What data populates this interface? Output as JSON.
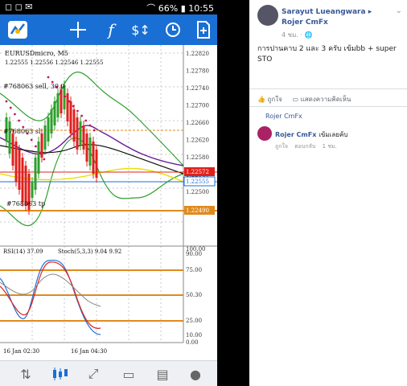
{
  "statusbar": {
    "battery": "66%",
    "time": "10:55"
  },
  "chart": {
    "symbol": "EURUSDmicro, M5",
    "ohlc": "1.22555 1.22556 1.22546 1.22555",
    "order1": "#768063 sell, 30.0",
    "order2": "#768063 sl",
    "order3": "#768063 tp",
    "rsi_label": "RSI(14) 37.09",
    "stoch_label": "Stoch(5,3,3) 9.04 9.92",
    "time_left": "16 Jan 02:30",
    "time_right": "16 Jan 04:30",
    "price_scale": [
      "1.22820",
      "1.22780",
      "1.22740",
      "1.22700",
      "1.22660",
      "1.22620",
      "1.22580",
      "1.22540",
      "1.22500",
      "1.22460"
    ],
    "highlight_red": "1.22572",
    "highlight_blue": "1.22555",
    "highlight_orange": "1.22490",
    "osc_scale": [
      "100.00",
      "90.00",
      "75.00",
      "50.30",
      "25.00",
      "10.00",
      "0.00"
    ],
    "colors": {
      "toolbar": "#1a6fd4",
      "bear": "#e0201c",
      "bull": "#2ca02c",
      "sar": "#c2185b",
      "level": "#e08a1e"
    }
  },
  "toolbar_icons": [
    "app-logo-icon",
    "crosshair-icon",
    "function-icon",
    "trade-icon",
    "clock-icon",
    "add-chart-icon"
  ],
  "bottombar_icons": [
    "quotes-icon",
    "chart-icon",
    "trade-icon",
    "history-icon",
    "news-icon",
    "chat-icon"
  ],
  "facebook": {
    "author": "Sarayut Lueangwara ▸ Rojer CmFx",
    "time": "4 ชม. · 🌐",
    "body": "การปานคาบ 2 และ 3 ครับ เข้มbb + super STO",
    "like": "ถูกใจ",
    "comment": "แสดงความคิดเห็น",
    "tag": "Rojer CmFx",
    "comment_author": "Rojer CmFx",
    "comment_text": "เข้มเลยค้บ",
    "comment_like": "ถูกใจ",
    "comment_reply": "ตอบกลับ",
    "comment_time": "1 ชม."
  }
}
